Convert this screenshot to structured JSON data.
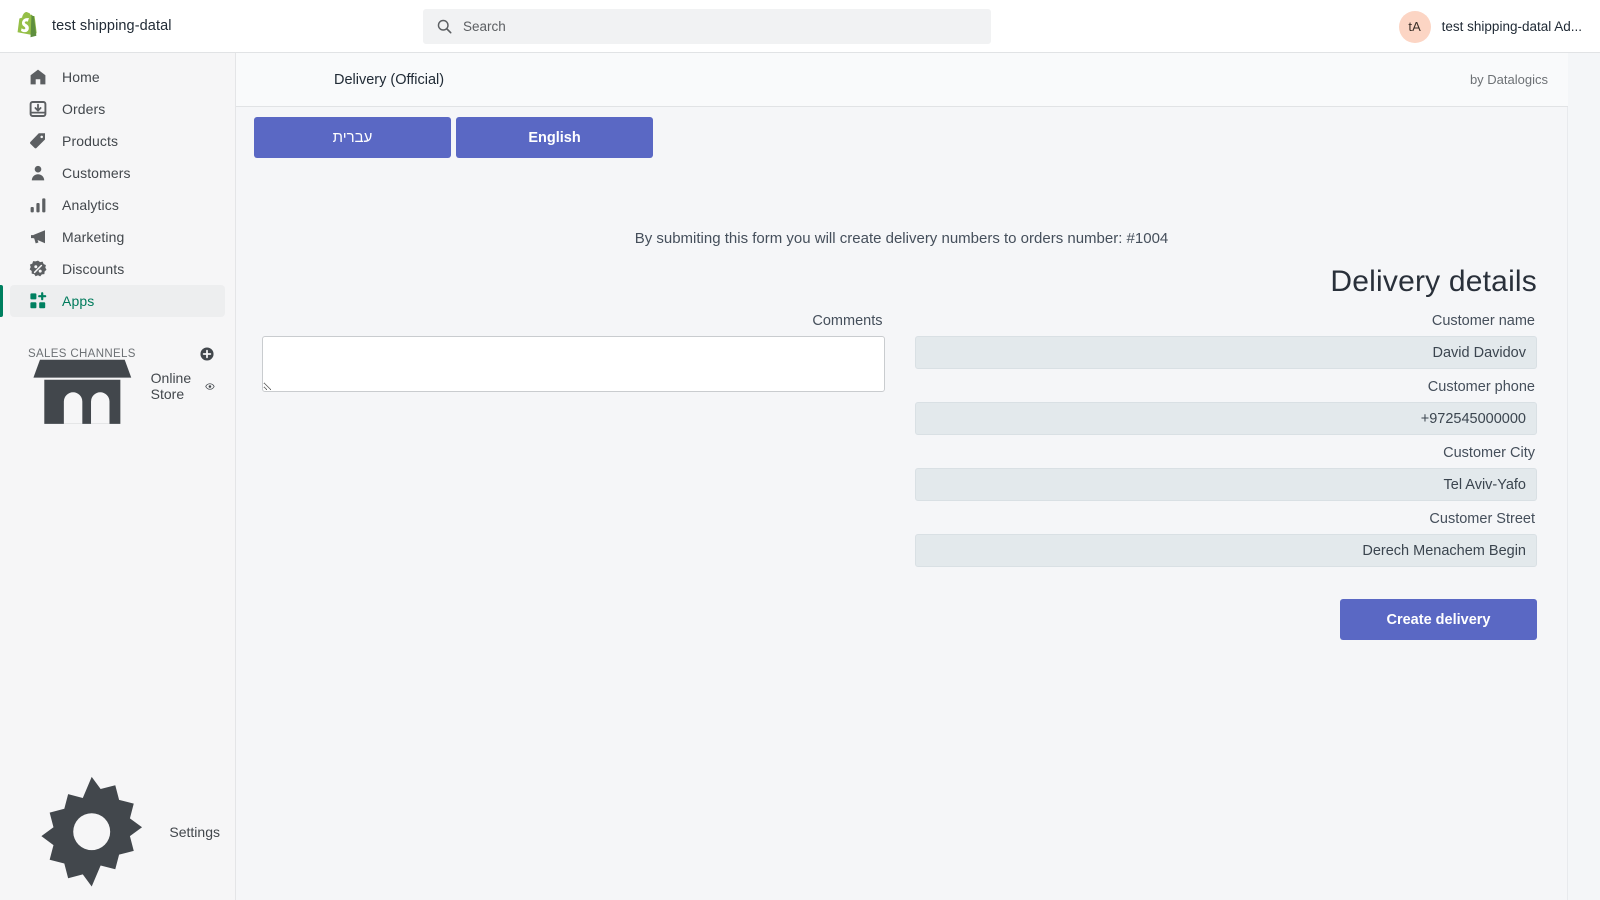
{
  "topbar": {
    "store_name": "test shipping-datal",
    "logo_icon": "shopify-bag-icon",
    "search": {
      "icon": "search-icon",
      "placeholder": "Search",
      "value": ""
    },
    "account": {
      "avatar_initials": "tA",
      "avatar_bg": "#fcd5c4",
      "name": "test shipping-datal Ad..."
    }
  },
  "sidebar": {
    "items": [
      {
        "label": "Home",
        "icon": "home-icon",
        "active": false
      },
      {
        "label": "Orders",
        "icon": "orders-icon",
        "active": false
      },
      {
        "label": "Products",
        "icon": "tag-icon",
        "active": false
      },
      {
        "label": "Customers",
        "icon": "person-icon",
        "active": false
      },
      {
        "label": "Analytics",
        "icon": "bar-chart-icon",
        "active": false
      },
      {
        "label": "Marketing",
        "icon": "megaphone-icon",
        "active": false
      },
      {
        "label": "Discounts",
        "icon": "discount-icon",
        "active": false
      },
      {
        "label": "Apps",
        "icon": "apps-icon",
        "active": true
      }
    ],
    "section": {
      "title": "SALES CHANNELS",
      "add_icon": "plus-circle-icon"
    },
    "channels": [
      {
        "label": "Online Store",
        "icon": "storefront-icon",
        "action_icon": "eye-icon"
      }
    ],
    "settings": {
      "label": "Settings",
      "icon": "gear-icon"
    },
    "active_color": "#007b5c"
  },
  "app": {
    "header": {
      "title": "Delivery (Official)",
      "by": "by Datalogics"
    },
    "language_buttons": [
      {
        "label": "עברית",
        "lang": "he"
      },
      {
        "label": "English",
        "lang": "en"
      }
    ],
    "accent_color": "#5a68c4",
    "form_note": "By submiting this form you will create delivery numbers to orders number: #1004",
    "details_title": "Delivery details",
    "comments": {
      "label": "Comments",
      "value": "",
      "placeholder": ""
    },
    "fields": [
      {
        "label": "Customer name",
        "value": "David Davidov",
        "name": "customer-name"
      },
      {
        "label": "Customer phone",
        "value": "972545000000+",
        "name": "customer-phone"
      },
      {
        "label": "Customer City",
        "value": "Tel Aviv-Yafo",
        "name": "customer-city"
      },
      {
        "label": "Customer Street",
        "value": "Derech Menachem Begin",
        "name": "customer-street"
      }
    ],
    "submit_label": "Create delivery"
  }
}
